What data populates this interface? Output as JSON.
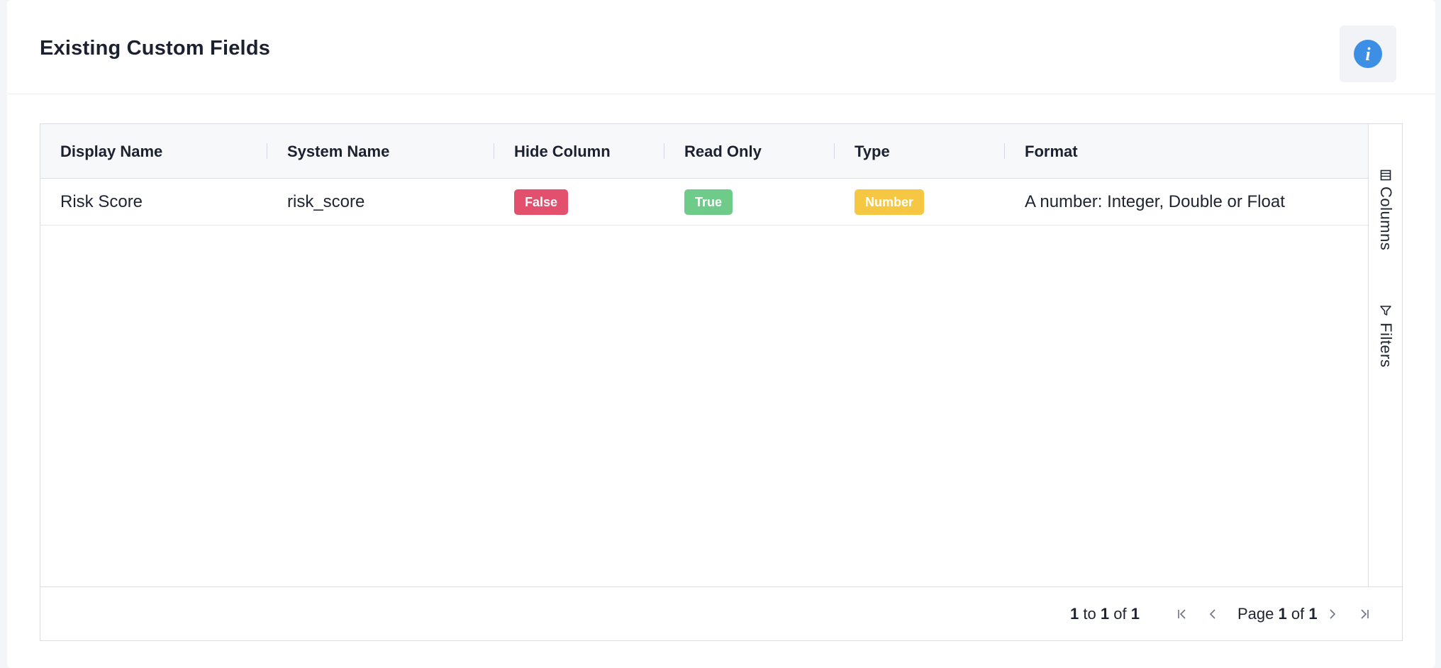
{
  "header": {
    "title": "Existing Custom Fields",
    "info_icon": "info-icon"
  },
  "table": {
    "columns": [
      "Display Name",
      "System Name",
      "Hide Column",
      "Read Only",
      "Type",
      "Format"
    ],
    "rows": [
      {
        "display_name": "Risk Score",
        "system_name": "risk_score",
        "hide_column": "False",
        "read_only": "True",
        "type": "Number",
        "format": "A number: Integer, Double or Float"
      }
    ]
  },
  "side_panel": {
    "columns_label": "Columns",
    "filters_label": "Filters"
  },
  "footer": {
    "row_from": "1",
    "row_to_word": "to",
    "row_to": "1",
    "of_word": "of",
    "row_total": "1",
    "page_word": "Page",
    "page_current": "1",
    "page_of_word": "of",
    "page_total": "1"
  },
  "colors": {
    "badge_false": "#e2506e",
    "badge_true": "#6ecb8a",
    "badge_number": "#f5c743",
    "info_blue": "#3d8fe6"
  }
}
